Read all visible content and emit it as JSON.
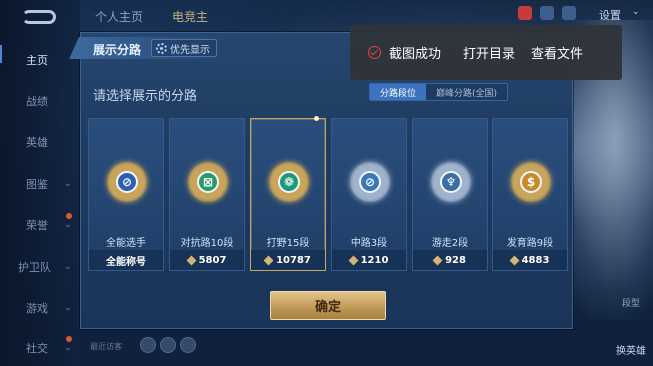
{
  "nav": {
    "items": [
      {
        "label": "主页",
        "active": true
      },
      {
        "label": "战绩"
      },
      {
        "label": "英雄"
      },
      {
        "label": "图鉴",
        "chevron": "⌄"
      },
      {
        "label": "荣誉",
        "chevron": "⌄"
      },
      {
        "label": "护卫队",
        "chevron": "⌄"
      },
      {
        "label": "游戏",
        "chevron": "⌄"
      },
      {
        "label": "社交",
        "chevron": "⌄"
      }
    ]
  },
  "top": {
    "tab_profile": "个人主页",
    "tab_second": "电竞主",
    "settings": "设置",
    "settings_chevron": "⌄"
  },
  "dialog": {
    "title": "展示分路",
    "priority_label": "优先显示",
    "subtitle": "请选择展示的分路",
    "seg_left": "分路段位",
    "seg_right": "巅峰分路(全国)",
    "confirm": "确定"
  },
  "cards": [
    {
      "label": "全能选手",
      "footer": "全能称号",
      "icon": "all-round-badge-icon",
      "ring": "#c9a55c",
      "inner": "#2f5fb0",
      "glyph": "⊘",
      "show_diamond": false
    },
    {
      "label": "对抗路10段",
      "footer": "5807",
      "icon": "clash-lane-badge-icon",
      "ring": "#c9a55c",
      "inner": "#2a9a6a",
      "glyph": "⊠",
      "show_diamond": true
    },
    {
      "label": "打野15段",
      "footer": "10787",
      "icon": "jungle-badge-icon",
      "ring": "#c9a55c",
      "inner": "#1f9a78",
      "glyph": "❁",
      "show_diamond": true,
      "selected": true
    },
    {
      "label": "中路3段",
      "footer": "1210",
      "icon": "mid-lane-badge-icon",
      "ring": "#9fb3cc",
      "inner": "#3a78b8",
      "glyph": "⊘",
      "show_diamond": true
    },
    {
      "label": "游走2段",
      "footer": "928",
      "icon": "roam-badge-icon",
      "ring": "#9fb3cc",
      "inner": "#3a6ea8",
      "glyph": "♆",
      "show_diamond": true
    },
    {
      "label": "发育路9段",
      "footer": "4883",
      "icon": "farm-lane-badge-icon",
      "ring": "#c9a55c",
      "inner": "#c98a2e",
      "glyph": "$",
      "show_diamond": true
    }
  ],
  "toast": {
    "message": "截图成功",
    "open_folder": "打开目录",
    "view_file": "查看文件"
  },
  "bottom": {
    "recent": "最近访客",
    "skin": "换英雄",
    "hall": "段型"
  },
  "colors": {
    "accent_blue": "#3b73c2",
    "gold": "#c9a468",
    "toast_bg": "#30343a"
  }
}
